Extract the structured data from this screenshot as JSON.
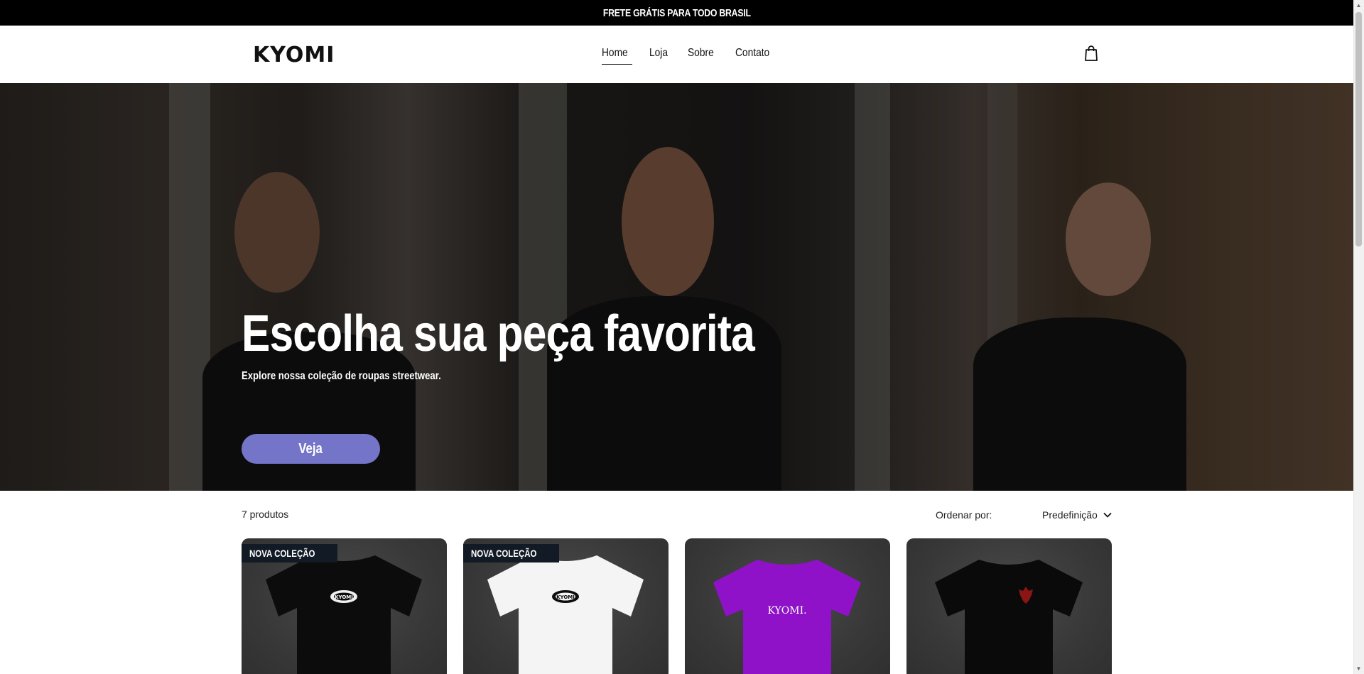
{
  "announcement": {
    "text": "FRETE GRÁTIS PARA TODO BRASIL"
  },
  "header": {
    "logo": "KYOMI",
    "nav": [
      {
        "label": "Home",
        "active": true
      },
      {
        "label": "Loja",
        "active": false
      },
      {
        "label": "Sobre",
        "active": false
      },
      {
        "label": "Contato",
        "active": false
      }
    ],
    "cart_icon": "shopping-bag-icon"
  },
  "hero": {
    "title": "Escolha sua peça favorita",
    "subtitle": "Explore nossa coleção de roupas streetwear.",
    "button_label": "Veja",
    "button_color": "#7474c8"
  },
  "shop": {
    "count_label": "7 produtos",
    "sort_label": "Ordenar por:",
    "sort_value": "Predefinição",
    "sort_icon": "chevron-down-icon",
    "products": [
      {
        "badge": "NOVA COLEÇÃO",
        "shirt_color": "#0c0c0c",
        "print": "kyomi-oval-logo",
        "print_text": "KYOMI"
      },
      {
        "badge": "NOVA COLEÇÃO",
        "shirt_color": "#f4f4f4",
        "print": "kyomi-oval-logo",
        "print_text": "KYOMI"
      },
      {
        "badge": "",
        "shirt_color": "#8f12c8",
        "print": "kyomi-script-logo",
        "print_text": "KYOMI."
      },
      {
        "badge": "",
        "shirt_color": "#0a0a0a",
        "print": "red-demon-mask",
        "print_text": ""
      }
    ]
  }
}
